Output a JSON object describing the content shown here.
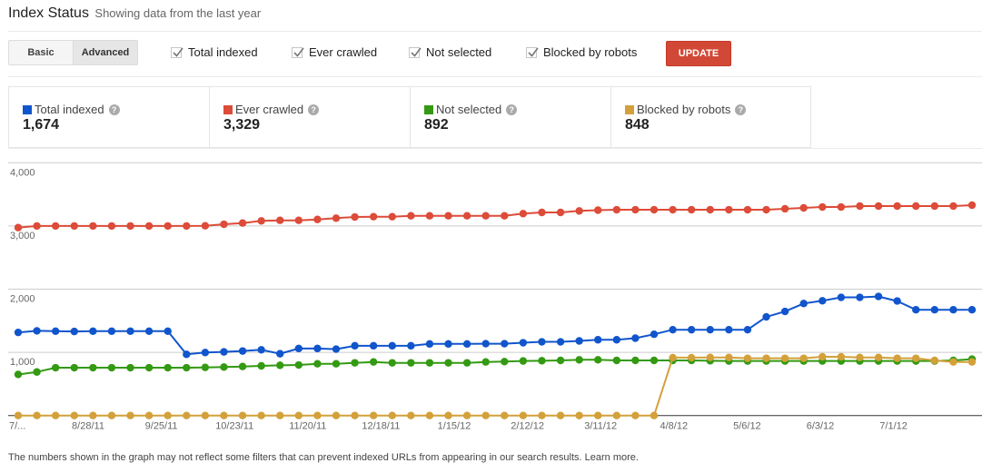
{
  "header": {
    "title": "Index Status",
    "subtitle": "Showing data from the last year"
  },
  "toolbar": {
    "view_modes": [
      {
        "label": "Basic",
        "selected": false
      },
      {
        "label": "Advanced",
        "selected": true
      }
    ],
    "checkboxes": [
      {
        "label": "Total indexed",
        "checked": true
      },
      {
        "label": "Ever crawled",
        "checked": true
      },
      {
        "label": "Not selected",
        "checked": true
      },
      {
        "label": "Blocked by robots",
        "checked": true
      }
    ],
    "update_label": "UPDATE",
    "update_color": "#d14836"
  },
  "summary": [
    {
      "label": "Total indexed",
      "value": "1,674",
      "color": "#1155cc",
      "help_icon": "?"
    },
    {
      "label": "Ever crawled",
      "value": "3,329",
      "color": "#dd4b39",
      "help_icon": "?"
    },
    {
      "label": "Not selected",
      "value": "892",
      "color": "#339a12",
      "help_icon": "?"
    },
    {
      "label": "Blocked by robots",
      "value": "848",
      "color": "#d3a03a",
      "help_icon": "?"
    }
  ],
  "footnote": "The numbers shown in the graph may not reflect some filters that can prevent indexed URLs from appearing in our search results. Learn more.",
  "chart_data": {
    "type": "line",
    "title": "",
    "xlabel": "",
    "ylabel": "",
    "ylim": [
      0,
      4000
    ],
    "yticks": [
      1000,
      2000,
      3000,
      4000
    ],
    "ytick_labels": [
      "1,000",
      "2,000",
      "3,000",
      "4,000"
    ],
    "xtick_labels": [
      "7/...",
      "8/28/11",
      "9/25/11",
      "10/23/11",
      "11/20/11",
      "12/18/11",
      "1/15/12",
      "2/12/12",
      "3/11/12",
      "4/8/12",
      "5/6/12",
      "6/3/12",
      "7/1/12"
    ],
    "grid": true,
    "legend": "none",
    "n_points": 52,
    "series": [
      {
        "name": "Ever crawled",
        "color": "#dd4b39",
        "values": [
          2974,
          3000,
          3000,
          3000,
          3000,
          3000,
          3000,
          3000,
          3000,
          3000,
          3003,
          3027,
          3046,
          3080,
          3089,
          3089,
          3103,
          3123,
          3142,
          3147,
          3147,
          3161,
          3161,
          3161,
          3161,
          3161,
          3161,
          3195,
          3214,
          3214,
          3238,
          3250,
          3257,
          3257,
          3257,
          3257,
          3257,
          3257,
          3257,
          3257,
          3257,
          3272,
          3286,
          3300,
          3300,
          3315,
          3315,
          3315,
          3315,
          3315,
          3315,
          3329
        ]
      },
      {
        "name": "Total indexed",
        "color": "#1155cc",
        "values": [
          1315,
          1340,
          1335,
          1330,
          1335,
          1335,
          1335,
          1335,
          1335,
          968,
          997,
          1007,
          1021,
          1040,
          978,
          1061,
          1061,
          1051,
          1104,
          1104,
          1104,
          1104,
          1133,
          1133,
          1133,
          1137,
          1137,
          1152,
          1166,
          1166,
          1181,
          1199,
          1199,
          1224,
          1286,
          1358,
          1358,
          1358,
          1358,
          1358,
          1561,
          1647,
          1773,
          1816,
          1870,
          1870,
          1884,
          1812,
          1674,
          1674,
          1674,
          1674
        ]
      },
      {
        "name": "Not selected",
        "color": "#339a12",
        "values": [
          650,
          689,
          757,
          757,
          757,
          757,
          757,
          757,
          757,
          757,
          762,
          767,
          776,
          786,
          795,
          800,
          819,
          819,
          834,
          848,
          834,
          834,
          834,
          834,
          834,
          848,
          853,
          863,
          867,
          872,
          882,
          882,
          872,
          872,
          872,
          872,
          872,
          867,
          863,
          863,
          863,
          863,
          863,
          863,
          863,
          863,
          863,
          863,
          863,
          863,
          872,
          892
        ]
      },
      {
        "name": "Blocked by robots",
        "color": "#d3a03a",
        "values": [
          0,
          0,
          0,
          0,
          0,
          0,
          0,
          0,
          0,
          0,
          0,
          0,
          0,
          0,
          0,
          0,
          0,
          0,
          0,
          0,
          0,
          0,
          0,
          0,
          0,
          0,
          0,
          0,
          0,
          0,
          0,
          0,
          0,
          0,
          0,
          916,
          916,
          920,
          920,
          906,
          906,
          906,
          906,
          930,
          930,
          920,
          920,
          906,
          906,
          872,
          848,
          848
        ]
      }
    ]
  }
}
